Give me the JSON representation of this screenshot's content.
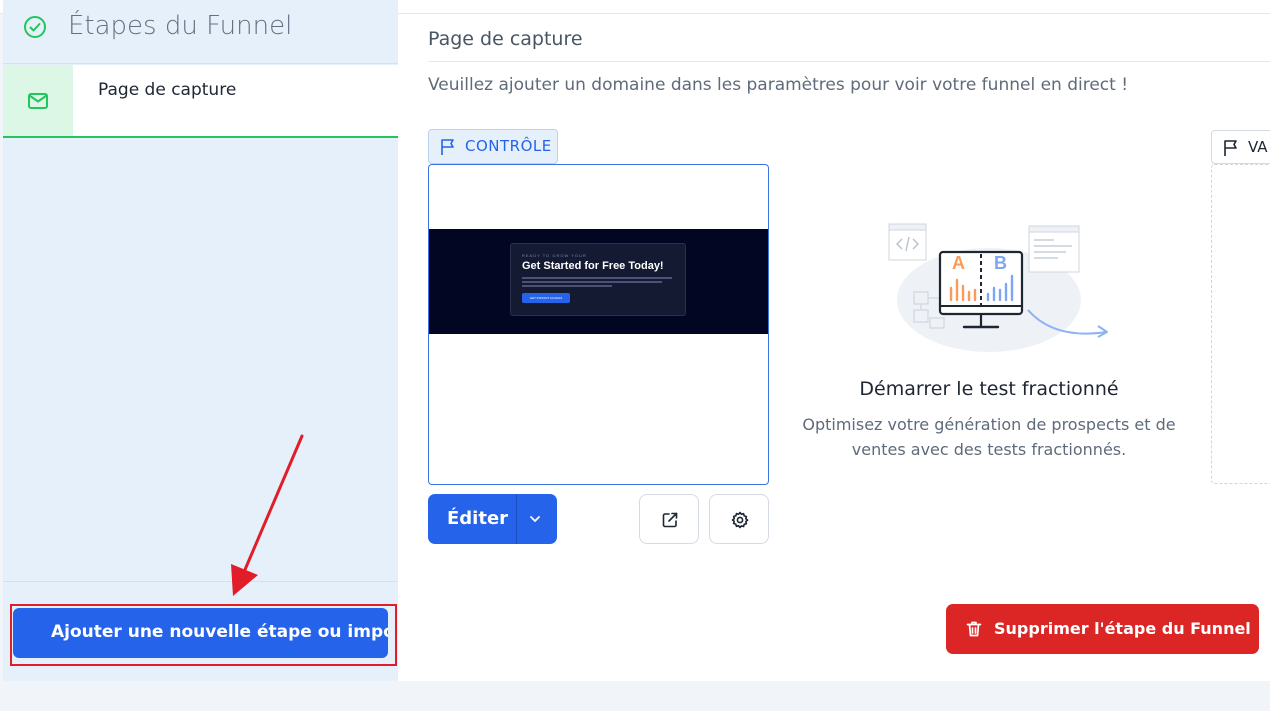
{
  "sidebar": {
    "title": "Étapes du Funnel",
    "steps": [
      {
        "label": "Page de capture"
      }
    ],
    "add_button": "Ajouter une nouvelle étape ou importer"
  },
  "main": {
    "page_title": "Page de capture",
    "notice": "Veuillez ajouter un domaine dans les paramètres pour voir votre funnel en direct !",
    "control_badge": "CONTRÔLE",
    "variant_badge": "VA",
    "preview": {
      "eyebrow": "READY TO GROW YOUR",
      "heading": "Get Started for Free Today!",
      "cta": "GET INSTANT ACCESS"
    },
    "edit_button": "Éditer",
    "split_test": {
      "title": "Démarrer le test fractionné",
      "description": "Optimisez votre génération de prospects et de ventes avec des tests fractionnés.",
      "label_a": "A",
      "label_b": "B"
    },
    "delete_button": "Supprimer l'étape du Funnel"
  },
  "colors": {
    "primary": "#2563eb",
    "danger": "#dc2626",
    "success": "#22c55e",
    "annotation": "#e01d28",
    "sidebar_bg": "#e6f0fb"
  },
  "icons": [
    "check-circle-icon",
    "mail-icon",
    "flag-icon",
    "chevron-down-icon",
    "external-link-icon",
    "gear-icon",
    "trash-icon",
    "ab-test-illustration"
  ]
}
